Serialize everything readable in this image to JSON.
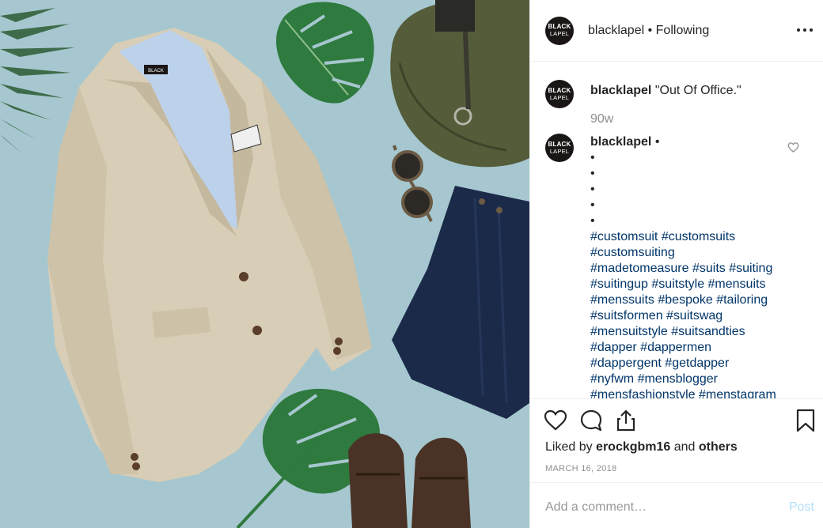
{
  "photo": {
    "label": "BLACK"
  },
  "header": {
    "avatar": {
      "line1": "BLACK",
      "line2": "LAPEL"
    },
    "username": "blacklapel",
    "separator": " • ",
    "follow_status": "Following"
  },
  "caption": {
    "username": "blacklapel",
    "text": "\"Out Of Office.\"",
    "time": "90w"
  },
  "comment": {
    "username": "blacklapel",
    "suffix": " •",
    "dots": [
      "•",
      "•",
      "•",
      "•",
      "•"
    ],
    "hashtags": [
      "#customsuit #customsuits",
      "#customsuiting",
      "#madetomeasure #suits #suiting",
      "#suitingup #suitstyle #mensuits",
      "#menssuits #bespoke #tailoring",
      "#suitsformen #suitswag",
      "#mensuitstyle #suitsandties",
      "#dapper #dappermen",
      "#dappergent #getdapper",
      "#nyfwm #mensblogger",
      "#mensfashionstyle #menstagram"
    ]
  },
  "likes": {
    "prefix": "Liked by ",
    "user": "erockgbm16",
    "middle": " and ",
    "others": "others"
  },
  "date": "MARCH 16, 2018",
  "add_comment": {
    "placeholder": "Add a comment…",
    "post_label": "Post"
  },
  "colors": {
    "link": "#003569",
    "muted": "#8e8e8e",
    "post_disabled": "#b2dffc",
    "photo_bg": "#a6c7cf"
  },
  "icons": [
    "more-options-icon",
    "heart-icon",
    "comment-icon",
    "share-icon",
    "bookmark-icon",
    "like-comment-heart-icon"
  ]
}
